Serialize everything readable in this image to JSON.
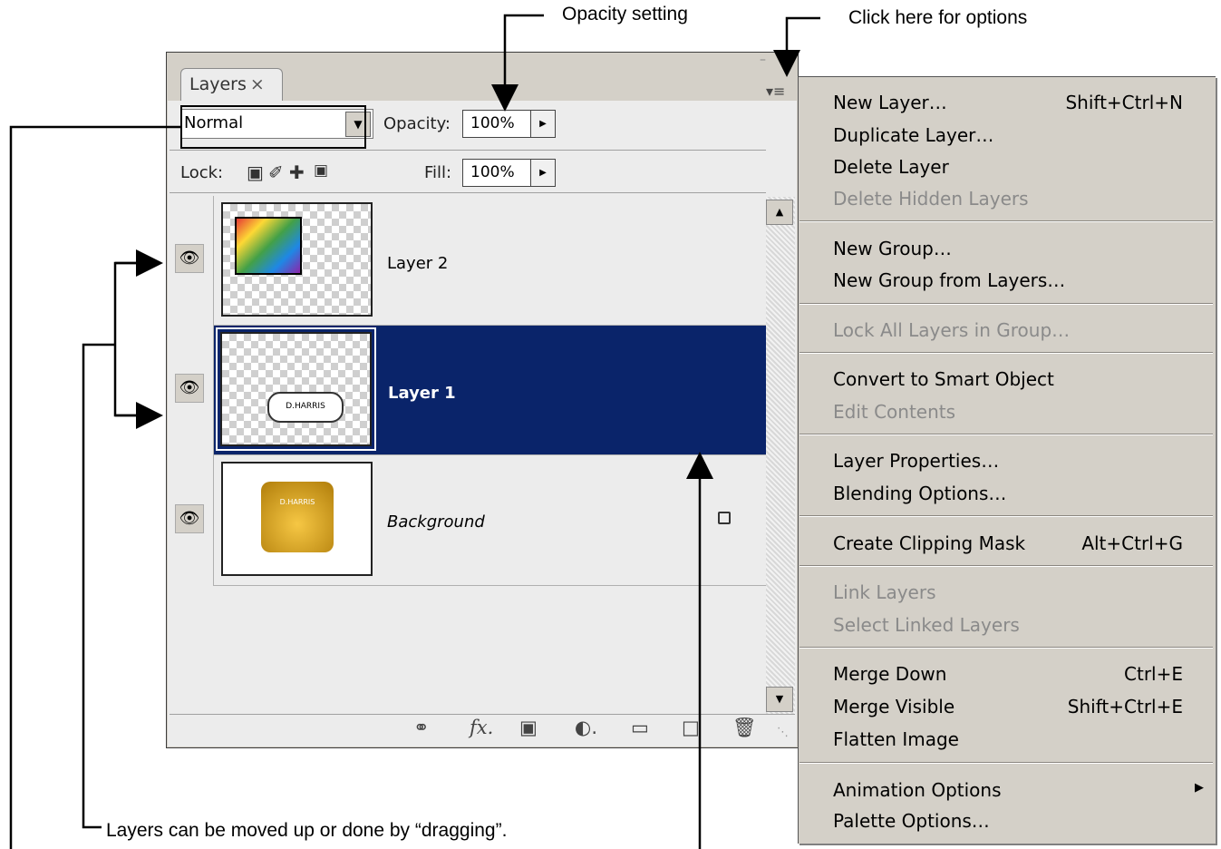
{
  "annotations": {
    "opacity_setting": "Opacity setting",
    "click_options": "Click here for options",
    "dragging_note": "Layers can be moved up or done by “dragging”."
  },
  "panel": {
    "tab_label": "Layers",
    "tab_close": "×",
    "blend_mode": "Normal",
    "opacity_label": "Opacity:",
    "opacity_value": "100%",
    "lock_label": "Lock:",
    "fill_label": "Fill:",
    "fill_value": "100%",
    "lock_icons": [
      "lock-transparent-icon",
      "lock-paint-icon",
      "lock-move-icon",
      "lock-all-icon"
    ],
    "layers": [
      {
        "name": "Layer 2",
        "selected": false,
        "visible": true,
        "locked": false
      },
      {
        "name": "Layer 1",
        "selected": true,
        "visible": true,
        "locked": false
      },
      {
        "name": "Background",
        "selected": false,
        "visible": true,
        "locked": true
      }
    ],
    "bottom_icons": [
      "link-icon",
      "fx-icon",
      "mask-icon",
      "adjustment-icon",
      "folder-icon",
      "new-layer-icon",
      "trash-icon"
    ]
  },
  "menu": {
    "items": [
      {
        "label": "New Layer…",
        "shortcut": "Shift+Ctrl+N",
        "disabled": false
      },
      {
        "label": "Duplicate Layer…",
        "shortcut": "",
        "disabled": false
      },
      {
        "label": "Delete Layer",
        "shortcut": "",
        "disabled": false
      },
      {
        "label": "Delete Hidden Layers",
        "shortcut": "",
        "disabled": true
      },
      {
        "label": "New Group…",
        "shortcut": "",
        "disabled": false
      },
      {
        "label": "New Group from Layers…",
        "shortcut": "",
        "disabled": false
      },
      {
        "label": "Lock All Layers in Group…",
        "shortcut": "",
        "disabled": true
      },
      {
        "label": "Convert to Smart Object",
        "shortcut": "",
        "disabled": false
      },
      {
        "label": "Edit Contents",
        "shortcut": "",
        "disabled": true
      },
      {
        "label": "Layer Properties…",
        "shortcut": "",
        "disabled": false
      },
      {
        "label": "Blending Options…",
        "shortcut": "",
        "disabled": false
      },
      {
        "label": "Create Clipping Mask",
        "shortcut": "Alt+Ctrl+G",
        "disabled": false
      },
      {
        "label": "Link Layers",
        "shortcut": "",
        "disabled": true
      },
      {
        "label": "Select Linked Layers",
        "shortcut": "",
        "disabled": true
      },
      {
        "label": "Merge Down",
        "shortcut": "Ctrl+E",
        "disabled": false
      },
      {
        "label": "Merge Visible",
        "shortcut": "Shift+Ctrl+E",
        "disabled": false
      },
      {
        "label": "Flatten Image",
        "shortcut": "",
        "disabled": false
      },
      {
        "label": "Animation Options",
        "shortcut": "",
        "disabled": false,
        "submenu": true
      },
      {
        "label": "Palette Options…",
        "shortcut": "",
        "disabled": false
      }
    ]
  },
  "colors": {
    "selection": "#0a246a",
    "panel_bg": "#ececec",
    "menu_bg": "#d4d0c8",
    "disabled_text": "#8a8a8a"
  }
}
